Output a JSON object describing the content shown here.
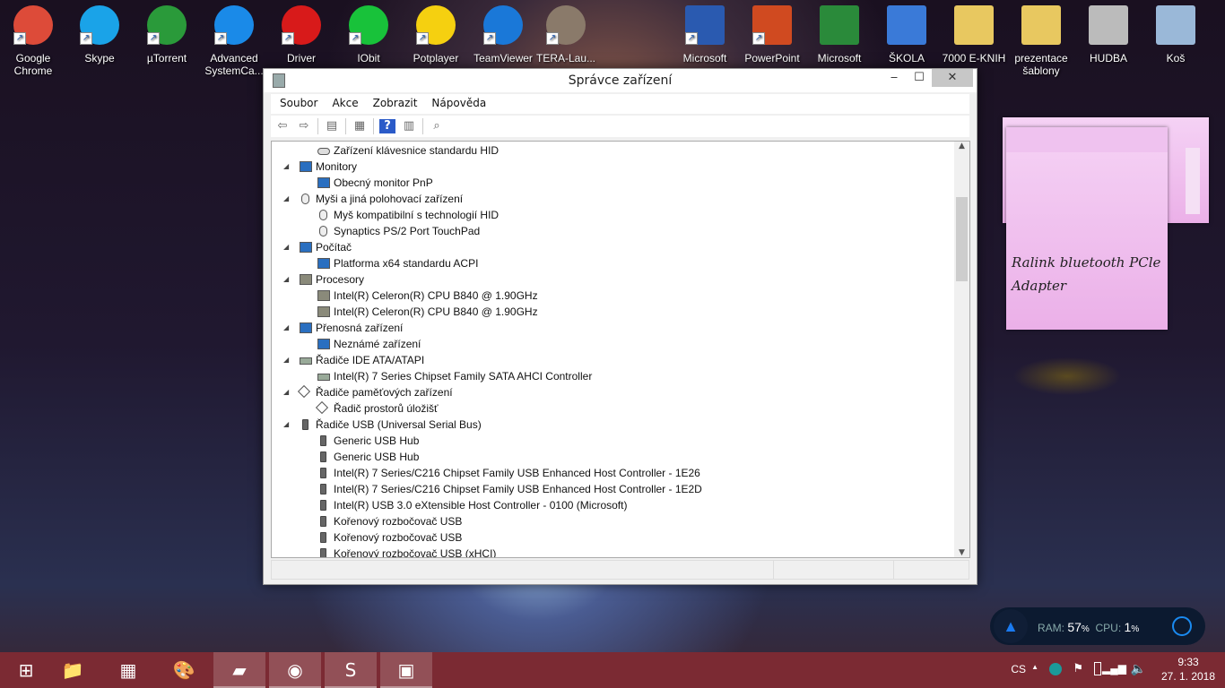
{
  "desktop": {
    "icons": [
      {
        "label": "Google Chrome",
        "color": "#dd4b39"
      },
      {
        "label": "Skype",
        "color": "#1aa3e8"
      },
      {
        "label": "µTorrent",
        "color": "#2a9a3a"
      },
      {
        "label": "Advanced SystemCa...",
        "color": "#1a8ae8"
      },
      {
        "label": "Driver",
        "color": "#d81a1a"
      },
      {
        "label": "IObit",
        "color": "#18c23a"
      },
      {
        "label": "Potplayer",
        "color": "#f5d010"
      },
      {
        "label": "TeamViewer",
        "color": "#1a78d8"
      },
      {
        "label": "TERA-Lau...",
        "color": "#8a7a6a"
      },
      {
        "label": "Microsoft",
        "color": "#2a5ab0"
      },
      {
        "label": "PowerPoint",
        "color": "#d04a20"
      },
      {
        "label": "Microsoft",
        "color": "#2a8a3a"
      },
      {
        "label": "ŠKOLA",
        "color": "#3a7ad8"
      },
      {
        "label": "7000 E-KNIH",
        "color": "#e8c860"
      },
      {
        "label": "prezentace šablony",
        "color": "#e8c860"
      },
      {
        "label": "HUDBA",
        "color": "#bbbbbb"
      },
      {
        "label": "Koš",
        "color": "#9ab8d8"
      }
    ]
  },
  "window": {
    "title": "Správce zařízení",
    "minimize": "‒",
    "maximize": "☐",
    "close": "✕",
    "menu": [
      "Soubor",
      "Akce",
      "Zobrazit",
      "Nápověda"
    ],
    "toolbar": [
      "back",
      "forward",
      "show-hide-console-tree",
      "properties",
      "help",
      "action-pane",
      "scan-hardware"
    ],
    "tree": [
      {
        "level": 1,
        "label": "Zařízení klávesnice standardu HID",
        "icon": "kbd"
      },
      {
        "level": 0,
        "label": "Monitory",
        "icon": "mon"
      },
      {
        "level": 1,
        "label": "Obecný monitor PnP",
        "icon": "mon"
      },
      {
        "level": 0,
        "label": "Myši a jiná polohovací zařízení",
        "icon": "mouse"
      },
      {
        "level": 1,
        "label": "Myš kompatibilní s technologií HID",
        "icon": "mouse"
      },
      {
        "level": 1,
        "label": "Synaptics PS/2 Port TouchPad",
        "icon": "mouse"
      },
      {
        "level": 0,
        "label": "Počítač",
        "icon": "mon"
      },
      {
        "level": 1,
        "label": "Platforma x64 standardu ACPI",
        "icon": "mon"
      },
      {
        "level": 0,
        "label": "Procesory",
        "icon": "cpu"
      },
      {
        "level": 1,
        "label": "Intel(R) Celeron(R) CPU B840 @ 1.90GHz",
        "icon": "cpu"
      },
      {
        "level": 1,
        "label": "Intel(R) Celeron(R) CPU B840 @ 1.90GHz",
        "icon": "cpu"
      },
      {
        "level": 0,
        "label": "Přenosná zařízení",
        "icon": "mon"
      },
      {
        "level": 1,
        "label": "Neznámé zařízení",
        "icon": "mon"
      },
      {
        "level": 0,
        "label": "Řadiče IDE ATA/ATAPI",
        "icon": "disk"
      },
      {
        "level": 1,
        "label": "Intel(R) 7 Series Chipset Family SATA AHCI Controller",
        "icon": "disk"
      },
      {
        "level": 0,
        "label": "Řadiče paměťových zařízení",
        "icon": "store"
      },
      {
        "level": 1,
        "label": "Řadič prostorů úložišť",
        "icon": "store"
      },
      {
        "level": 0,
        "label": "Řadiče USB (Universal Serial Bus)",
        "icon": "usb"
      },
      {
        "level": 1,
        "label": "Generic USB Hub",
        "icon": "usb"
      },
      {
        "level": 1,
        "label": "Generic USB Hub",
        "icon": "usb"
      },
      {
        "level": 1,
        "label": "Intel(R) 7 Series/C216 Chipset Family USB Enhanced Host Controller - 1E26",
        "icon": "usb"
      },
      {
        "level": 1,
        "label": "Intel(R) 7 Series/C216 Chipset Family USB Enhanced Host Controller - 1E2D",
        "icon": "usb"
      },
      {
        "level": 1,
        "label": "Intel(R) USB 3.0 eXtensible Host Controller - 0100 (Microsoft)",
        "icon": "usb"
      },
      {
        "level": 1,
        "label": "Kořenový rozbočovač USB",
        "icon": "usb"
      },
      {
        "level": 1,
        "label": "Kořenový rozbočovač USB",
        "icon": "usb"
      },
      {
        "level": 1,
        "label": "Kořenový rozbočovač USB (xHCI)",
        "icon": "usb"
      }
    ]
  },
  "sticky_note": {
    "text": "Ralink bluetooth PCle Adapter"
  },
  "widget": {
    "ram_label": "RAM:",
    "ram_value": "57",
    "cpu_label": "CPU:",
    "cpu_value": "1",
    "unit": "%"
  },
  "taskbar": {
    "apps": [
      {
        "name": "start",
        "glyph": "⊞",
        "open": false
      },
      {
        "name": "file-explorer",
        "glyph": "📁",
        "open": false
      },
      {
        "name": "calculator",
        "glyph": "▦",
        "open": false
      },
      {
        "name": "paint",
        "glyph": "🎨",
        "open": false
      },
      {
        "name": "sticky-notes",
        "glyph": "▰",
        "open": true
      },
      {
        "name": "chrome",
        "glyph": "◉",
        "open": true
      },
      {
        "name": "skype",
        "glyph": "S",
        "open": true
      },
      {
        "name": "device-manager",
        "glyph": "▣",
        "open": true
      }
    ],
    "lang": "CS",
    "time": "9:33",
    "date": "27. 1. 2018"
  }
}
